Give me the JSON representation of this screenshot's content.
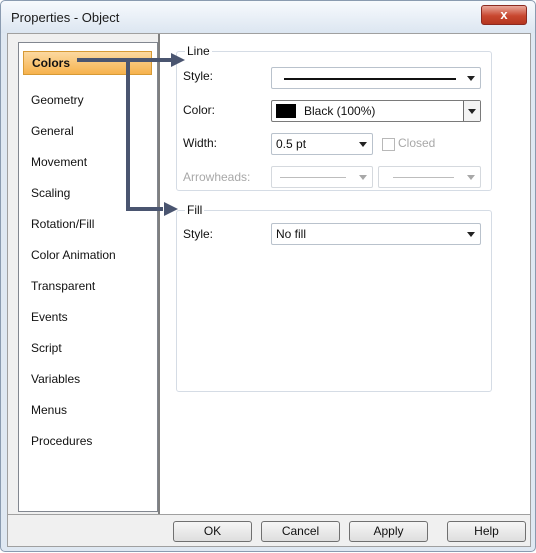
{
  "window": {
    "title": "Properties - Object",
    "close_glyph": "x"
  },
  "sidebar": {
    "items": [
      {
        "label": "Colors",
        "selected": true
      },
      {
        "label": "Geometry"
      },
      {
        "label": "General"
      },
      {
        "label": "Movement"
      },
      {
        "label": "Scaling"
      },
      {
        "label": "Rotation/Fill"
      },
      {
        "label": "Color Animation"
      },
      {
        "label": "Transparent"
      },
      {
        "label": "Events"
      },
      {
        "label": "Script"
      },
      {
        "label": "Variables"
      },
      {
        "label": "Menus"
      },
      {
        "label": "Procedures"
      }
    ]
  },
  "line_group": {
    "legend": "Line",
    "style_label": "Style:",
    "color_label": "Color:",
    "color_value": "Black (100%)",
    "color_hex": "#000000",
    "width_label": "Width:",
    "width_value": "0.5 pt",
    "closed_label": "Closed",
    "closed_checked": false,
    "arrowheads_label": "Arrowheads:"
  },
  "fill_group": {
    "legend": "Fill",
    "style_label": "Style:",
    "style_value": "No fill"
  },
  "buttons": {
    "ok": "OK",
    "cancel": "Cancel",
    "apply": "Apply",
    "help": "Help"
  },
  "colors": {
    "selection": "#f6b24d",
    "annotation_arrow": "#4a5570"
  }
}
